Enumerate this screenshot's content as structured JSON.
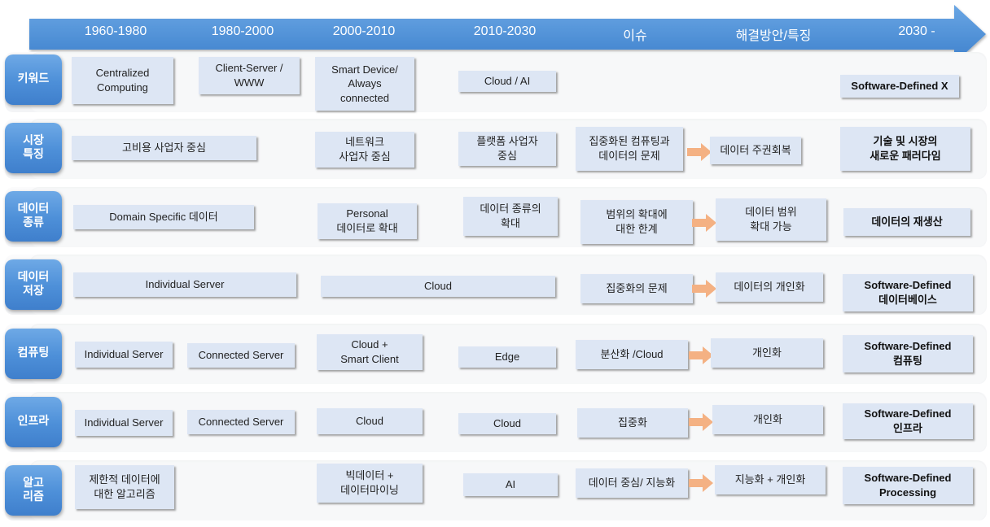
{
  "timeline": {
    "labels": [
      "1960-1980",
      "1980-2000",
      "2000-2010",
      "2010-2030",
      "이슈",
      "해결방안/특징",
      "2030 -"
    ],
    "arrow_color": "#5596d8"
  },
  "colors": {
    "category_fill": "#4d8fd8",
    "box_fill": "#dde6f4",
    "flow_arrow": "#f4b183"
  },
  "rows": [
    {
      "category": "키워드",
      "cells": [
        "Centralized\nComputing",
        "Client-Server /\nWWW",
        "Smart Device/\nAlways\nconnected",
        "Cloud / AI",
        "Software-Defined  X"
      ]
    },
    {
      "category": "시장\n특징",
      "cells": [
        "고비용 사업자 중심",
        "네트워크\n사업자 중심",
        "플랫폼 사업자\n중심",
        "집중화된 컴퓨팅과\n데이터의 문제",
        "데이터 주권회복",
        "기술 및 시장의\n새로운 패러다임"
      ]
    },
    {
      "category": "데이터\n종류",
      "cells": [
        "Domain Specific  데이터",
        "Personal\n데이터로 확대",
        "데이터 종류의\n확대",
        "범위의 확대에\n대한 한계",
        "데이터 범위\n확대 가능",
        "데이터의 재생산"
      ]
    },
    {
      "category": "데이터\n저장",
      "cells": [
        "Individual Server",
        "Cloud",
        "집중화의 문제",
        "데이터의 개인화",
        "Software-Defined\n데이터베이스"
      ]
    },
    {
      "category": "컴퓨팅",
      "cells": [
        "Individual Server",
        "Connected Server",
        "Cloud +\nSmart Client",
        "Edge",
        "분산화 /Cloud",
        "개인화",
        "Software-Defined\n컴퓨팅"
      ]
    },
    {
      "category": "인프라",
      "cells": [
        "Individual Server",
        "Connected Server",
        "Cloud",
        "Cloud",
        "집중화",
        "개인화",
        "Software-Defined\n인프라"
      ]
    },
    {
      "category": "알고\n리즘",
      "cells": [
        "제한적 데이터에\n대한 알고리즘",
        "빅데이터 +\n데이터마이닝",
        "AI",
        "데이터 중심/ 지능화",
        "지능화 + 개인화",
        "Software-Defined\nProcessing"
      ]
    }
  ]
}
